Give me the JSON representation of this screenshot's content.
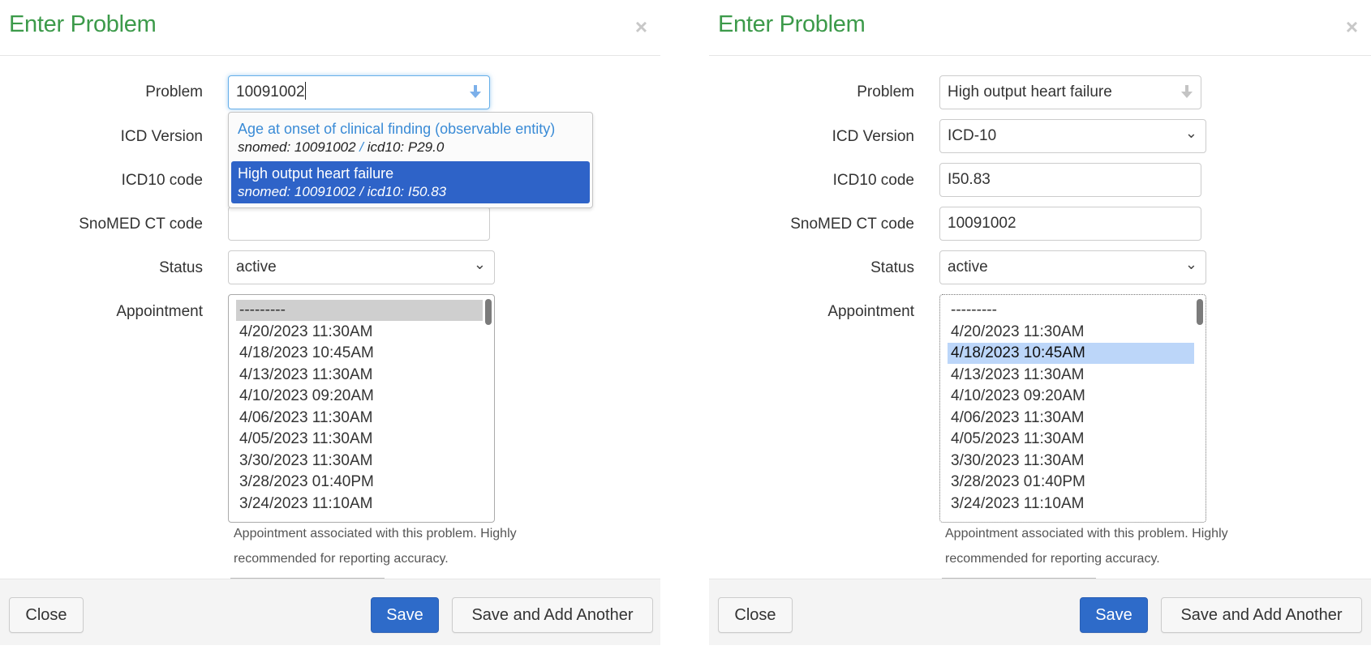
{
  "colors": {
    "title_green": "#3c9a4a",
    "primary_blue": "#2e6bc9",
    "highlight_blue": "#2e63c8",
    "list_selection": "#bcd6f9",
    "suggestion_link": "#3a8bd6"
  },
  "labels": {
    "problem": "Problem",
    "icd_version": "ICD Version",
    "icd10_code": "ICD10 code",
    "snomed_code": "SnoMED CT code",
    "status": "Status",
    "appointment": "Appointment"
  },
  "appointments": [
    "---------",
    "4/20/2023 11:30AM",
    "4/18/2023 10:45AM",
    "4/13/2023 11:30AM",
    "4/10/2023 09:20AM",
    "4/06/2023 11:30AM",
    "4/05/2023 11:30AM",
    "3/30/2023 11:30AM",
    "3/28/2023 01:40PM",
    "3/24/2023 11:10AM"
  ],
  "help_text": {
    "line1": "Appointment associated with this problem. Highly",
    "line2": "recommended for reporting accuracy."
  },
  "buttons": {
    "close": "Close",
    "save": "Save",
    "save_add": "Save and Add Another"
  },
  "left_dialog": {
    "title": "Enter Problem",
    "close_icon": "×",
    "problem_value": "10091002",
    "icd_version_value": "",
    "icd10_value": "",
    "snomed_value": "",
    "status_value": "active",
    "appointment_selected": "---------",
    "suggestions": [
      {
        "name": "Age at onset of clinical finding (observable entity)",
        "snomed": "snomed: 10091002",
        "separator": "/",
        "icd10": "icd10: P29.0",
        "active": false
      },
      {
        "name": "High output heart failure",
        "snomed": "snomed: 10091002",
        "separator": "/",
        "icd10": "icd10: I50.83",
        "active": true
      }
    ]
  },
  "right_dialog": {
    "title": "Enter Problem",
    "close_icon": "×",
    "problem_value": "High output heart failure",
    "icd_version_value": "ICD-10",
    "icd10_value": "I50.83",
    "snomed_value": "10091002",
    "status_value": "active",
    "appointment_selected": "4/18/2023 10:45AM"
  }
}
